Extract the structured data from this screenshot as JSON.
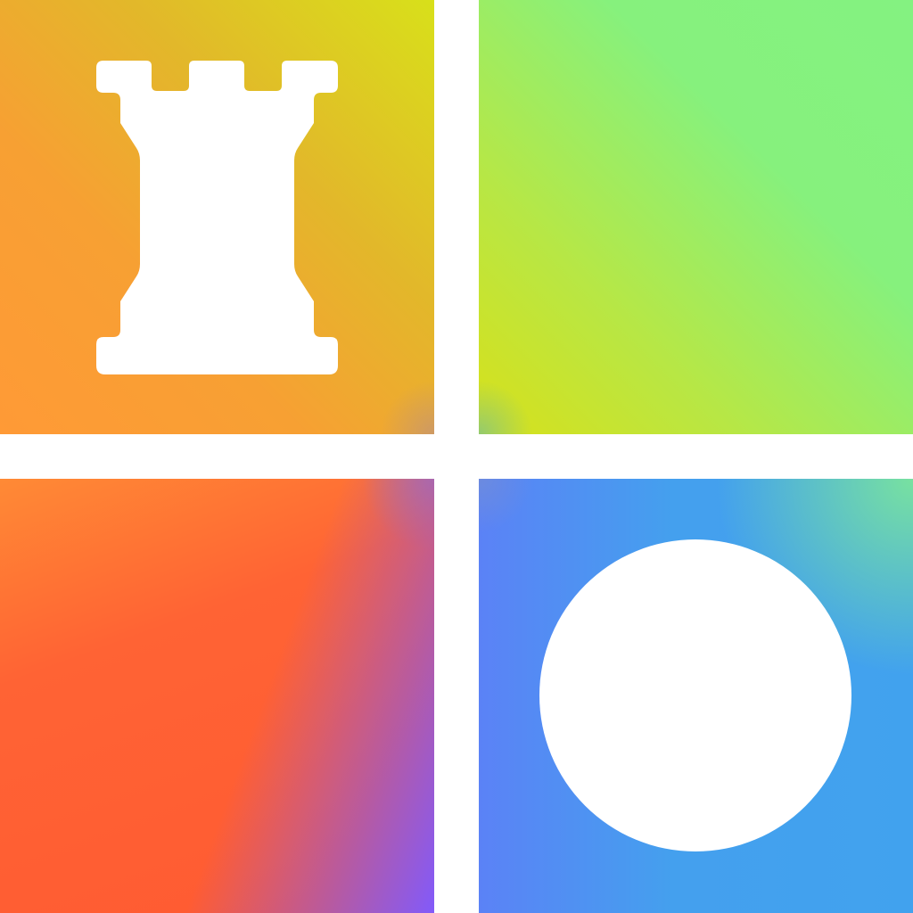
{
  "icon": {
    "tiles": [
      {
        "id": "top-left",
        "gradient_colors": [
          "#ff9a36",
          "#f7a033",
          "#e2b82a",
          "#d8e01a"
        ],
        "glyph": "rook-icon"
      },
      {
        "id": "top-right",
        "gradient_colors": [
          "#d8e01a",
          "#b7e745",
          "#86f17d",
          "#84f281"
        ],
        "glyph": null
      },
      {
        "id": "bottom-left",
        "gradient_colors": [
          "#ff8a35",
          "#ff5a32",
          "#aa5ab4",
          "#825afa"
        ],
        "glyph": null
      },
      {
        "id": "bottom-right",
        "gradient_colors": [
          "#5b82f6",
          "#41a2ee",
          "#78e1a0"
        ],
        "glyph": "circle-icon"
      }
    ],
    "divider_color": "#ffffff",
    "glyph_color": "#ffffff"
  }
}
